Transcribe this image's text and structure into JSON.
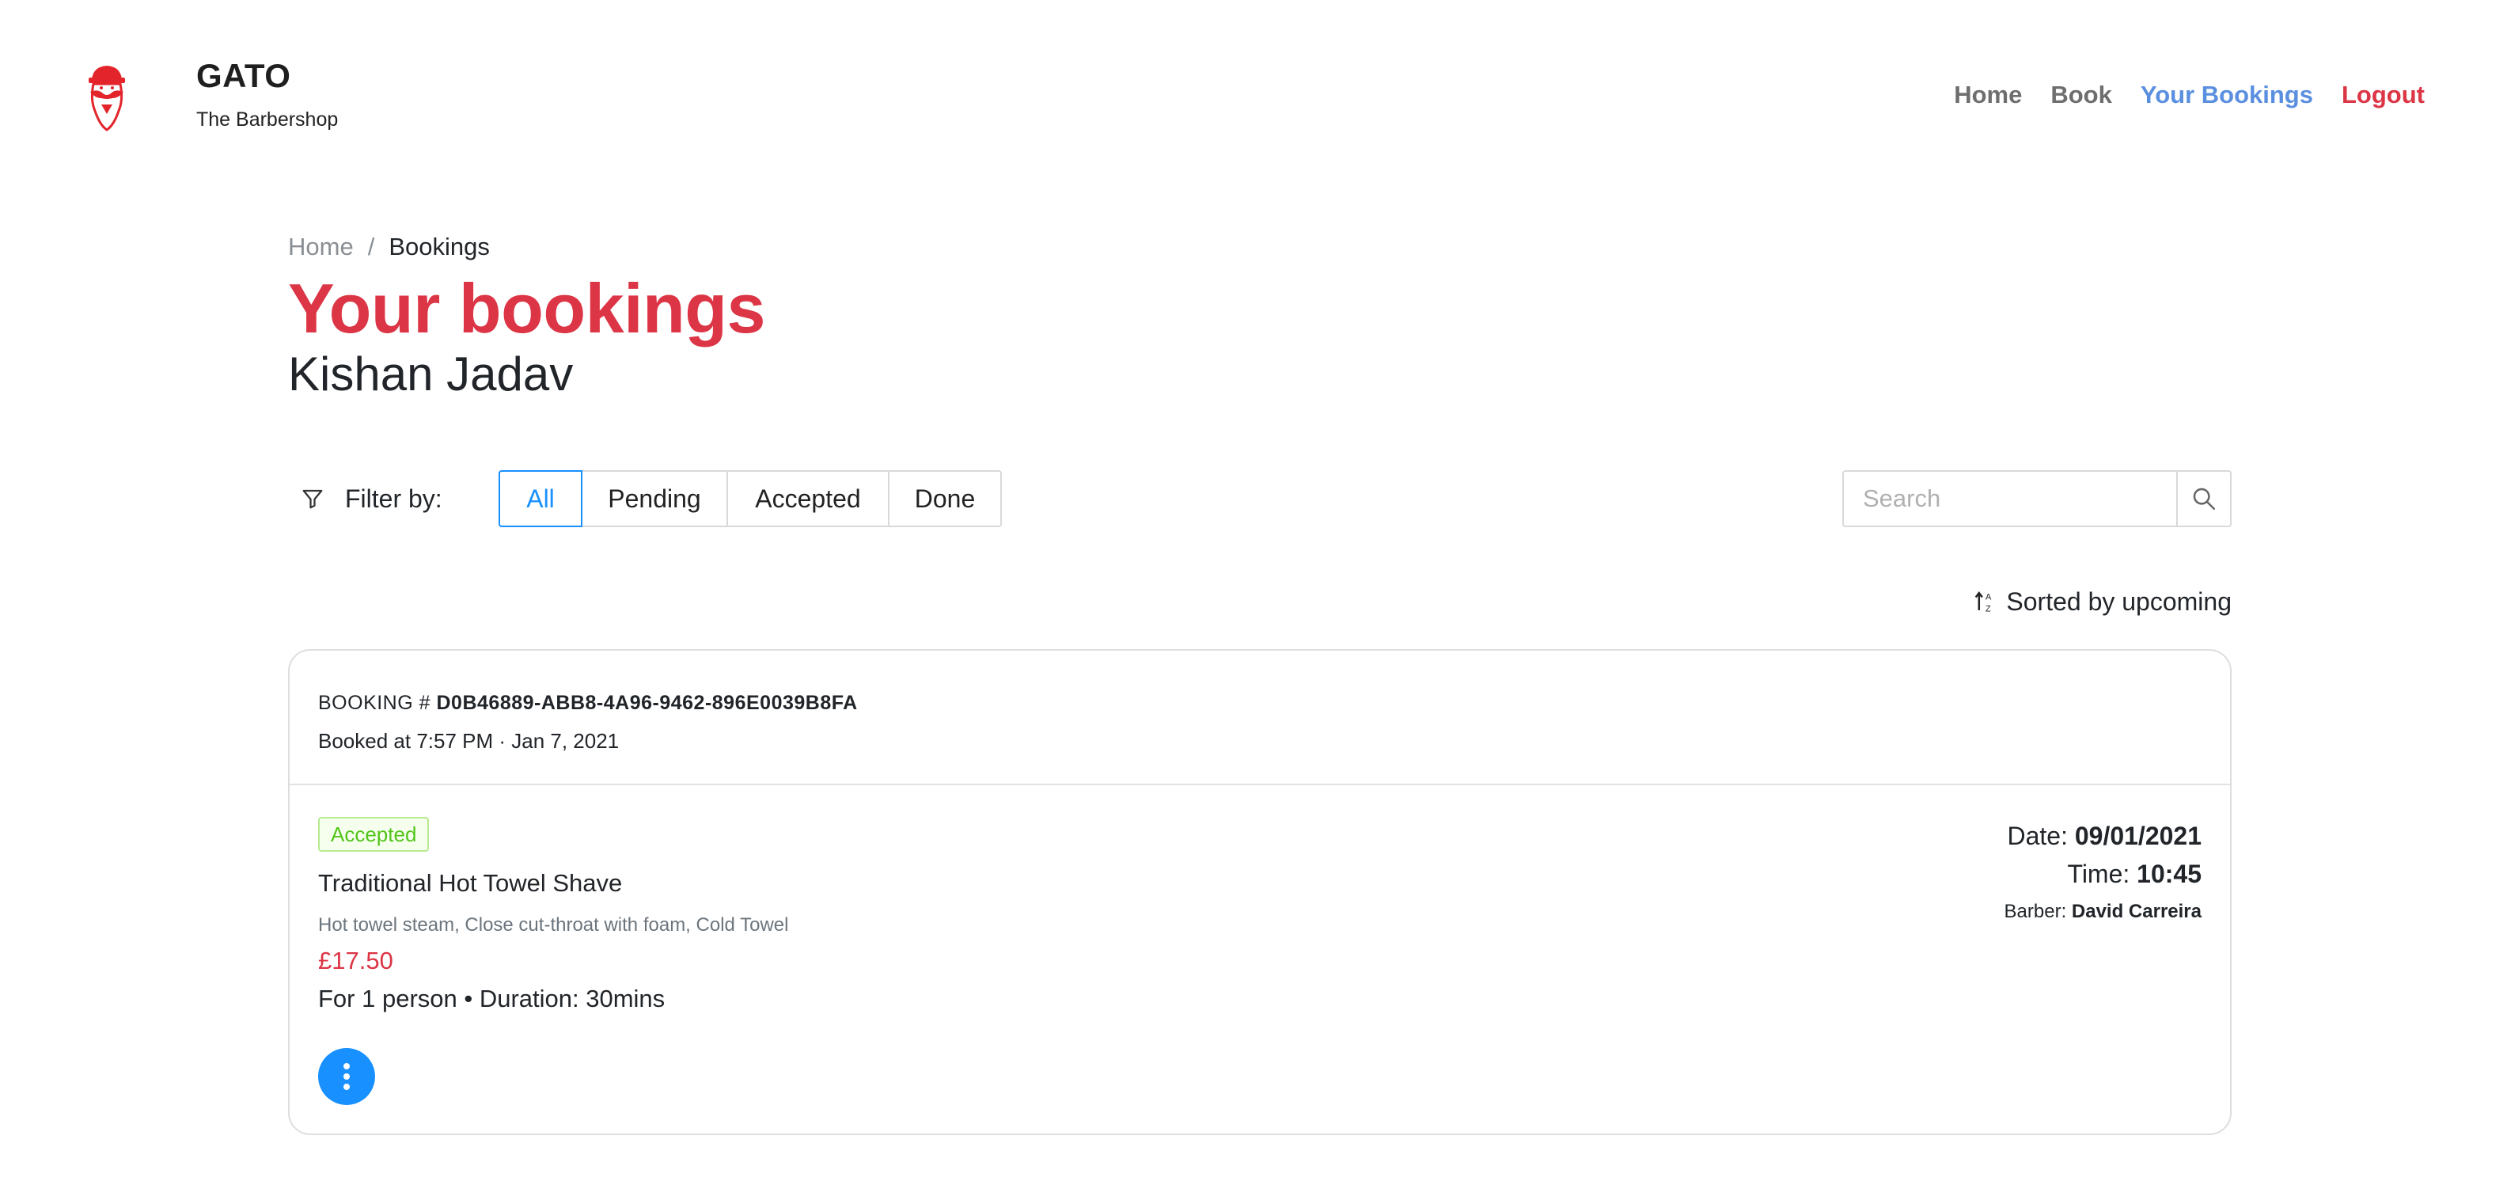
{
  "header": {
    "brand_name": "GATO",
    "brand_tagline": "The Barbershop",
    "nav": {
      "home": "Home",
      "book": "Book",
      "bookings": "Your Bookings",
      "logout": "Logout"
    }
  },
  "breadcrumb": {
    "home": "Home",
    "separator": "/",
    "current": "Bookings"
  },
  "page": {
    "title": "Your bookings",
    "user_name": "Kishan Jadav"
  },
  "filter": {
    "label": "Filter by:",
    "options": [
      "All",
      "Pending",
      "Accepted",
      "Done"
    ],
    "selected": "All"
  },
  "search": {
    "placeholder": "Search",
    "value": ""
  },
  "sort": {
    "label": "Sorted by upcoming"
  },
  "booking": {
    "id_prefix": "BOOKING #",
    "id": "D0B46889-ABB8-4A96-9462-896E0039B8FA",
    "booked_at": "Booked at 7:57 PM · Jan 7, 2021",
    "status": "Accepted",
    "service_name": "Traditional Hot Towel Shave",
    "service_description": "Hot towel steam, Close cut-throat with foam, Cold Towel",
    "price": "£17.50",
    "details": "For 1 person • Duration: 30mins",
    "date_label": "Date:",
    "date_value": "09/01/2021",
    "time_label": "Time:",
    "time_value": "10:45",
    "barber_label": "Barber:",
    "barber_value": "David Carreira"
  },
  "colors": {
    "brand_red": "#dc3545",
    "nav_active": "#5a8fe0",
    "primary_blue": "#1890ff",
    "status_green": "#52c41a"
  },
  "icons": {
    "logo": "mustache-hat-logo",
    "filter": "filter-funnel-icon",
    "search": "magnifier-icon",
    "sort": "sort-ascending-icon",
    "more": "vertical-dots-icon"
  }
}
